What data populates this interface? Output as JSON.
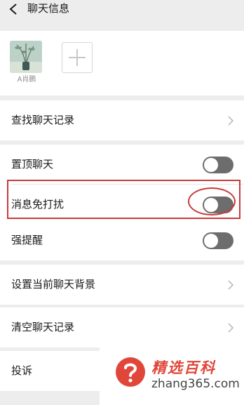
{
  "header": {
    "title": "聊天信息"
  },
  "members": [
    {
      "name": "A肖鹏"
    }
  ],
  "add_member": {
    "icon": "plus-icon"
  },
  "settings": {
    "search_history": "查找聊天记录",
    "pin_chat": {
      "label": "置顶聊天",
      "on": false
    },
    "mute": {
      "label": "消息免打扰",
      "on": false
    },
    "strong_reminder": {
      "label": "强提醒",
      "on": false
    },
    "set_background": "设置当前聊天背景",
    "clear_history": "清空聊天记录",
    "report": "投诉"
  },
  "watermark": {
    "title": "精选百科",
    "url": "zhang365.com"
  },
  "colors": {
    "page_bg": "#ededed",
    "toggle_off": "#6d6d6d",
    "highlight": "#c83a3a",
    "watermark_red": "#e1463a"
  }
}
